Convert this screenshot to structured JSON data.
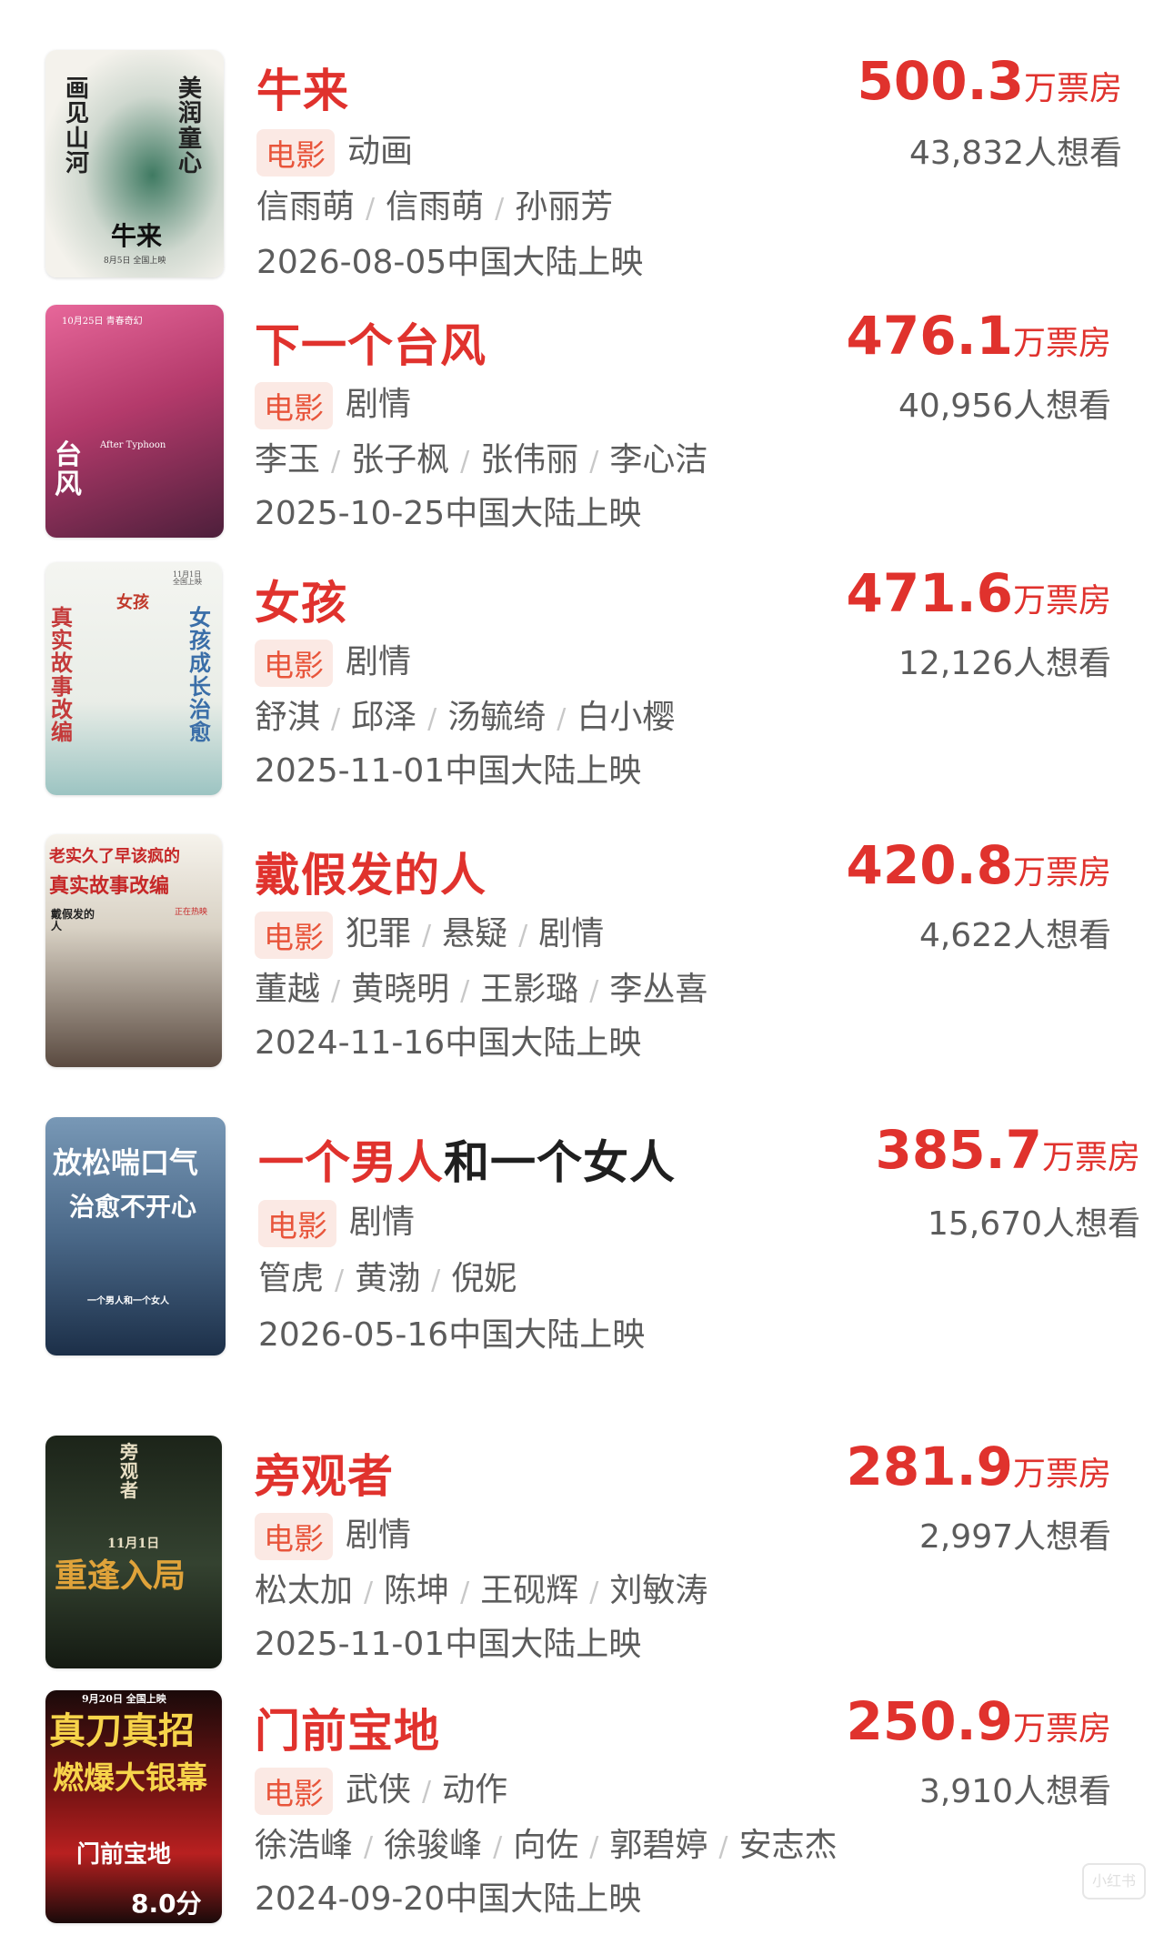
{
  "unit_label": "万票房",
  "genre_tag": "电影",
  "movies": [
    {
      "title": "牛来",
      "box_office": "500.3",
      "want": "43,832人想看",
      "genres": [
        "动画"
      ],
      "cast": [
        "信雨萌",
        "信雨萌",
        "孙丽芳"
      ],
      "release": "2026-08-05中国大陆上映",
      "poster_text": [
        "画见山河",
        "美润童心",
        "牛来",
        "8月5日 全国上映"
      ],
      "poster_colors": [
        "#f1efe8",
        "#2f5a4a"
      ]
    },
    {
      "title": "下一个台风",
      "box_office": "476.1",
      "want": "40,956人想看",
      "genres": [
        "剧情"
      ],
      "cast": [
        "李玉",
        "张子枫",
        "张伟丽",
        "李心洁"
      ],
      "release": "2025-10-25中国大陆上映",
      "poster_text": [
        "10月25日 青春奇幻",
        "After Typhoon",
        "台风"
      ],
      "poster_colors": [
        "#d84a7a",
        "#6b2a4a"
      ]
    },
    {
      "title": "女孩",
      "box_office": "471.6",
      "want": "12,126人想看",
      "genres": [
        "剧情"
      ],
      "cast": [
        "舒淇",
        "邱泽",
        "汤毓绮",
        "白小樱"
      ],
      "release": "2025-11-01中国大陆上映",
      "poster_text": [
        "真实故事改编",
        "女孩成长治愈",
        "11月1日 全国上映",
        "女孩"
      ],
      "poster_colors": [
        "#eef1ec",
        "#8fbab8"
      ]
    },
    {
      "title": "戴假发的人",
      "box_office": "420.8",
      "want": "4,622人想看",
      "genres": [
        "犯罪",
        "悬疑",
        "剧情"
      ],
      "cast": [
        "董越",
        "黄晓明",
        "王影璐",
        "李丛喜"
      ],
      "release": "2024-11-16中国大陆上映",
      "poster_text": [
        "老实久了早该疯的",
        "真实故事改编",
        "正在热映",
        "戴假发的人"
      ],
      "poster_colors": [
        "#f4f1ea",
        "#4a3a30"
      ]
    },
    {
      "title_red": "一个男人",
      "title_dark": "和一个女人",
      "box_office": "385.7",
      "want": "15,670人想看",
      "genres": [
        "剧情"
      ],
      "cast": [
        "管虎",
        "黄渤",
        "倪妮"
      ],
      "release": "2026-05-16中国大陆上映",
      "poster_text": [
        "放松喘口气",
        "治愈不开心",
        "一个男人和一个女人"
      ],
      "poster_colors": [
        "#5c7ea0",
        "#1f3350"
      ]
    },
    {
      "title": "旁观者",
      "box_office": "281.9",
      "want": "2,997人想看",
      "genres": [
        "剧情"
      ],
      "cast": [
        "松太加",
        "陈坤",
        "王砚辉",
        "刘敏涛"
      ],
      "release": "2025-11-01中国大陆上映",
      "poster_text": [
        "旁观者",
        "11月1日",
        "重逢入局"
      ],
      "poster_colors": [
        "#2d3a2a",
        "#0d120c"
      ]
    },
    {
      "title": "门前宝地",
      "box_office": "250.9",
      "want": "3,910人想看",
      "genres": [
        "武侠",
        "动作"
      ],
      "cast": [
        "徐浩峰",
        "徐骏峰",
        "向佐",
        "郭碧婷",
        "安志杰"
      ],
      "release": "2024-09-20中国大陆上映",
      "poster_text": [
        "9月20日 全国上映",
        "真刀真招",
        "燃爆大银幕",
        "门前宝地",
        "8.0分"
      ],
      "poster_colors": [
        "#b01818",
        "#1a0a0a"
      ]
    }
  ],
  "watermark": "小红书"
}
